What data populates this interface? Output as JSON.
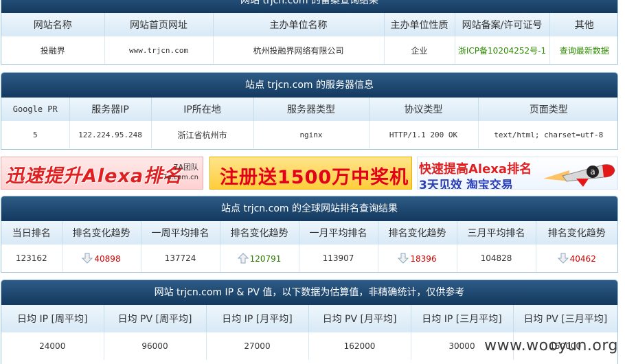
{
  "record": {
    "title": "网站 trjcn.com 的备案查询结果",
    "headers": [
      "网站名称",
      "网站首页网址",
      "主办单位名称",
      "主办单位性质",
      "网站备案/许可证号",
      "其他"
    ],
    "row": [
      "投融界",
      "www.trjcn.com",
      "杭州投融界网络有限公司",
      "企业",
      "浙ICP备10204252号-1",
      "查询最新数据"
    ]
  },
  "server": {
    "title": "站点 trjcn.com 的服务器信息",
    "headers": [
      "Google PR",
      "服务器IP",
      "IP所在地",
      "服务器类型",
      "协议类型",
      "页面类型"
    ],
    "row": [
      "5",
      "122.224.95.248",
      "浙江省杭州市",
      "nginx",
      "HTTP/1.1 200 OK",
      "text/html; charset=utf-8"
    ]
  },
  "banners": {
    "b1_text": "迅速提升Alexa排名",
    "b1_team": "7A团队",
    "b1_site": "7a.com.cn",
    "b2_text": "注册送1500万中奖机",
    "b3_line1": "快速提高Alexa排名",
    "b3_line2": "3天见效 淘宝交易"
  },
  "rank": {
    "title": "站点 trjcn.com 的全球网站排名查询结果",
    "headers": [
      "当日排名",
      "排名变化趋势",
      "一周平均排名",
      "排名变化趋势",
      "一月平均排名",
      "排名变化趋势",
      "三月平均排名",
      "排名变化趋势"
    ],
    "daily": "123162",
    "trend1": "40898",
    "weekly": "137724",
    "trend2": "120791",
    "monthly": "113907",
    "trend3": "18396",
    "quarterly": "104828",
    "trend4": "40462",
    "colors": {
      "up": "#2b7a00",
      "down": "#d00000"
    }
  },
  "ippv": {
    "title": "网站 trjcn.com IP & PV 值，以下数据为估算值，非精确统计，仅供参考",
    "headers": [
      "日均 IP [周平均]",
      "日均 PV [周平均]",
      "日均 IP [月平均]",
      "日均 PV [月平均]",
      "日均 IP [三月平均]",
      "日均 PV [三月平均]"
    ],
    "row": [
      "24000",
      "96000",
      "27000",
      "162000",
      "30000",
      "150000"
    ]
  },
  "watermark": "www.wooyun.org"
}
